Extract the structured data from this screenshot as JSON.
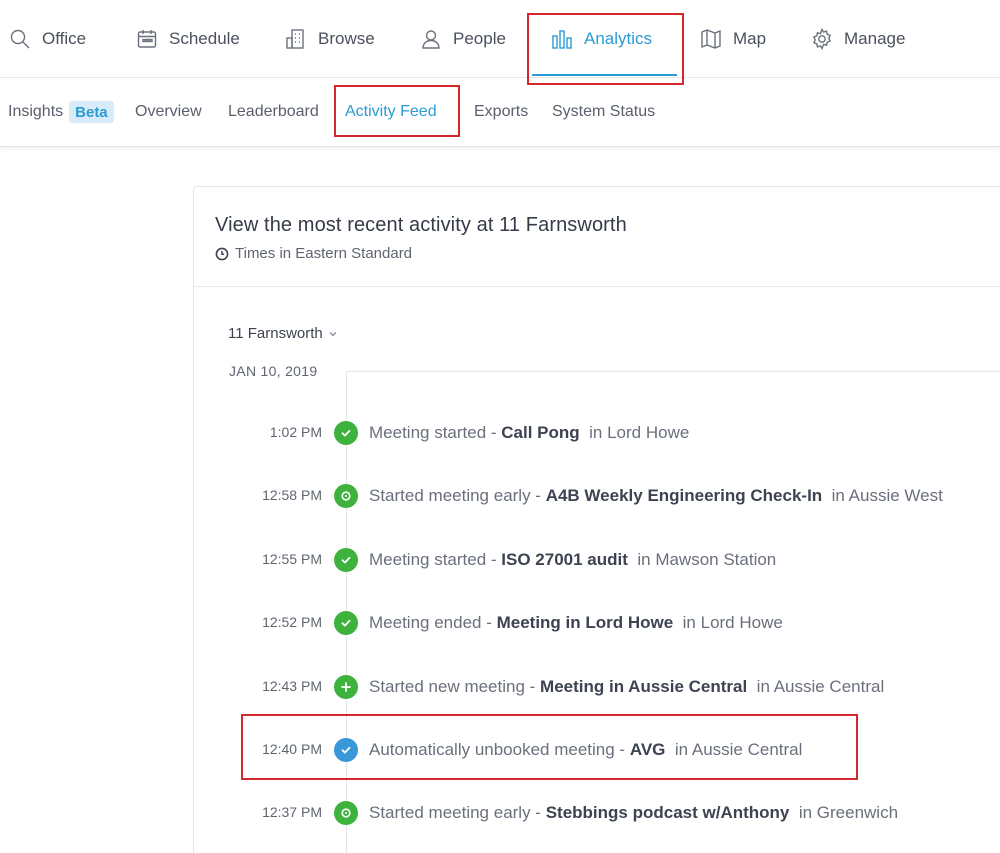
{
  "nav": {
    "items": [
      {
        "label": "Office",
        "icon": "search-icon"
      },
      {
        "label": "Schedule",
        "icon": "calendar-icon"
      },
      {
        "label": "Browse",
        "icon": "building-icon"
      },
      {
        "label": "People",
        "icon": "person-icon"
      },
      {
        "label": "Analytics",
        "icon": "bar-chart-icon",
        "active": true
      },
      {
        "label": "Map",
        "icon": "map-icon"
      },
      {
        "label": "Manage",
        "icon": "gear-icon"
      }
    ]
  },
  "subnav": {
    "items": [
      {
        "label": "Insights",
        "badge": "Beta"
      },
      {
        "label": "Overview"
      },
      {
        "label": "Leaderboard"
      },
      {
        "label": "Activity Feed",
        "active": true
      },
      {
        "label": "Exports"
      },
      {
        "label": "System Status"
      }
    ]
  },
  "card": {
    "title": "View the most recent activity at 11 Farnsworth",
    "subtitle": "Times in Eastern Standard",
    "location": "11 Farnsworth",
    "date": "JAN 10, 2019"
  },
  "events": [
    {
      "time": "1:02 PM",
      "action": "Meeting started - ",
      "meeting": "Call Pong",
      "location": "in Lord Howe",
      "type": "check",
      "color": "#3db33d"
    },
    {
      "time": "12:58 PM",
      "action": "Started meeting early - ",
      "meeting": "A4B Weekly Engineering Check-In",
      "location": "in Aussie West",
      "type": "clock",
      "color": "#3db33d"
    },
    {
      "time": "12:55 PM",
      "action": "Meeting started - ",
      "meeting": "ISO 27001 audit",
      "location": "in Mawson Station",
      "type": "check",
      "color": "#3db33d"
    },
    {
      "time": "12:52 PM",
      "action": "Meeting ended - ",
      "meeting": "Meeting in Lord Howe",
      "location": "in Lord Howe",
      "type": "check",
      "color": "#3db33d"
    },
    {
      "time": "12:43 PM",
      "action": "Started new meeting - ",
      "meeting": "Meeting in Aussie Central",
      "location": "in Aussie Central",
      "type": "plus",
      "color": "#3db33d"
    },
    {
      "time": "12:40 PM",
      "action": "Automatically unbooked meeting - ",
      "meeting": "AVG",
      "location": "in Aussie Central",
      "type": "check",
      "color": "#3a98d8"
    },
    {
      "time": "12:37 PM",
      "action": "Started meeting early - ",
      "meeting": "Stebbings podcast w/Anthony",
      "location": "in Greenwich",
      "type": "clock",
      "color": "#3db33d"
    }
  ],
  "colors": {
    "accent": "#2a9bd3",
    "annotation": "#d6262d",
    "success": "#3db33d",
    "info": "#3a98d8"
  }
}
